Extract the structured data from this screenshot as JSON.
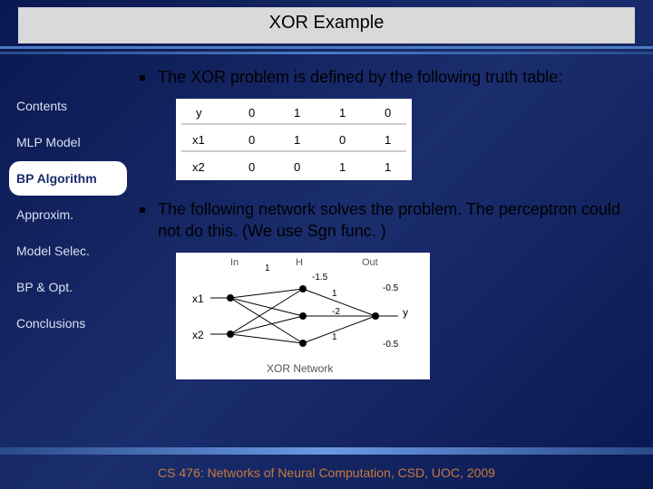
{
  "header": {
    "title": "XOR Example"
  },
  "sidebar": {
    "items": [
      {
        "label": "Contents"
      },
      {
        "label": "MLP Model"
      },
      {
        "label": "BP Algorithm"
      },
      {
        "label": "Approxim."
      },
      {
        "label": "Model Selec."
      },
      {
        "label": "BP & Opt."
      },
      {
        "label": "Conclusions"
      }
    ],
    "active_index": 2
  },
  "body": {
    "bullets": [
      "The XOR problem is defined by the following truth table:",
      "The following network solves the problem. The perceptron could not do this. (We use Sgn func. )"
    ]
  },
  "truth_table": {
    "rows": [
      {
        "label": "y",
        "vals": [
          "0",
          "1",
          "1",
          "0"
        ]
      },
      {
        "label": "x1",
        "vals": [
          "0",
          "1",
          "0",
          "1"
        ]
      },
      {
        "label": "x2",
        "vals": [
          "0",
          "0",
          "1",
          "1"
        ]
      }
    ]
  },
  "network": {
    "inputs": [
      "x1",
      "x2"
    ],
    "header": [
      "In",
      "H",
      "Out"
    ],
    "output_label": "y",
    "caption": "XOR Network",
    "biases": [
      "1",
      "-1.5",
      "-0.5",
      "-0.5"
    ],
    "mid_weights": [
      "1",
      "1",
      "-2"
    ]
  },
  "footer": {
    "text": "CS 476: Networks of Neural Computation, CSD, UOC, 2009"
  },
  "chart_data": {
    "type": "table",
    "title": "XOR truth table",
    "columns": [
      "x1",
      "x2",
      "y"
    ],
    "rows": [
      [
        0,
        0,
        0
      ],
      [
        1,
        0,
        1
      ],
      [
        0,
        1,
        1
      ],
      [
        1,
        1,
        0
      ]
    ]
  }
}
